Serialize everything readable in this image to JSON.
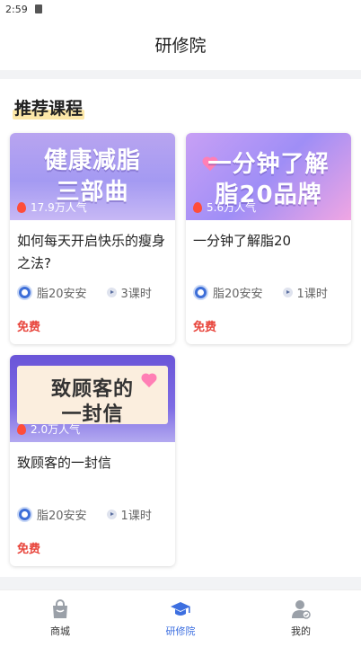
{
  "status": {
    "time": "2:59"
  },
  "header": {
    "title": "研修院"
  },
  "section": {
    "title": "推荐课程"
  },
  "courses": [
    {
      "thumb_line1": "健康减脂",
      "thumb_line2": "三部曲",
      "popularity": "17.9万人气",
      "title": "如何每天开启快乐的瘦身之法?",
      "author": "脂20安安",
      "lessons": "3课时",
      "price": "免费"
    },
    {
      "thumb_line1": "一分钟了解",
      "thumb_line2": "脂20品牌",
      "popularity": "5.6万人气",
      "title": "一分钟了解脂20",
      "author": "脂20安安",
      "lessons": "1课时",
      "price": "免费"
    },
    {
      "thumb_line1": "致顾客的",
      "thumb_line2": "一封信",
      "popularity": "2.0万人气",
      "title": "致顾客的一封信",
      "author": "脂20安安",
      "lessons": "1课时",
      "price": "免费"
    }
  ],
  "tabs": [
    {
      "label": "商城",
      "icon": "shopping-bag-icon"
    },
    {
      "label": "研修院",
      "icon": "graduation-cap-icon",
      "active": true
    },
    {
      "label": "我的",
      "icon": "user-icon"
    }
  ],
  "colors": {
    "accent": "#3d6fe0",
    "price": "#e8453c",
    "highlight": "#fde8a8"
  }
}
